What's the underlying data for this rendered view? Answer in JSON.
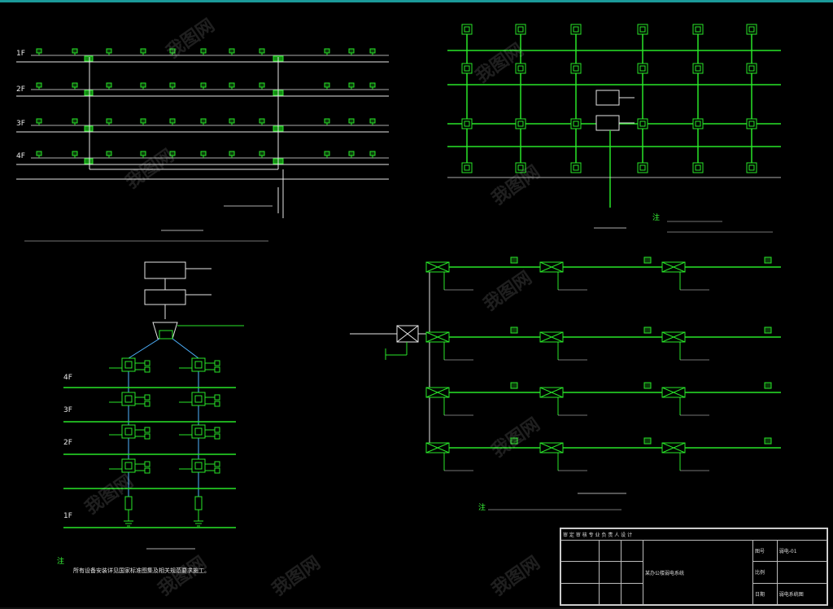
{
  "drawing": {
    "floor_labels": [
      "4F",
      "3F",
      "2F",
      "1F"
    ],
    "left_plan_labels": [
      "1F",
      "2F",
      "3F",
      "4F"
    ],
    "notes": {
      "note_mark": "注",
      "bottom_left_note_line": "所有设备安装详见国家标准图集及相关规范要求施工。"
    },
    "title_block": {
      "header": [
        "审",
        "定",
        "审",
        "核",
        "专",
        "业",
        "负",
        "责",
        "人",
        "设",
        "计"
      ],
      "project": "某办公楼弱电系统",
      "drawing_name": "弱电系统图",
      "sheet_label": "图号",
      "sheet_value": "弱电-01",
      "scale_label": "比例",
      "date_label": "日期"
    },
    "watermark": "我图网"
  }
}
